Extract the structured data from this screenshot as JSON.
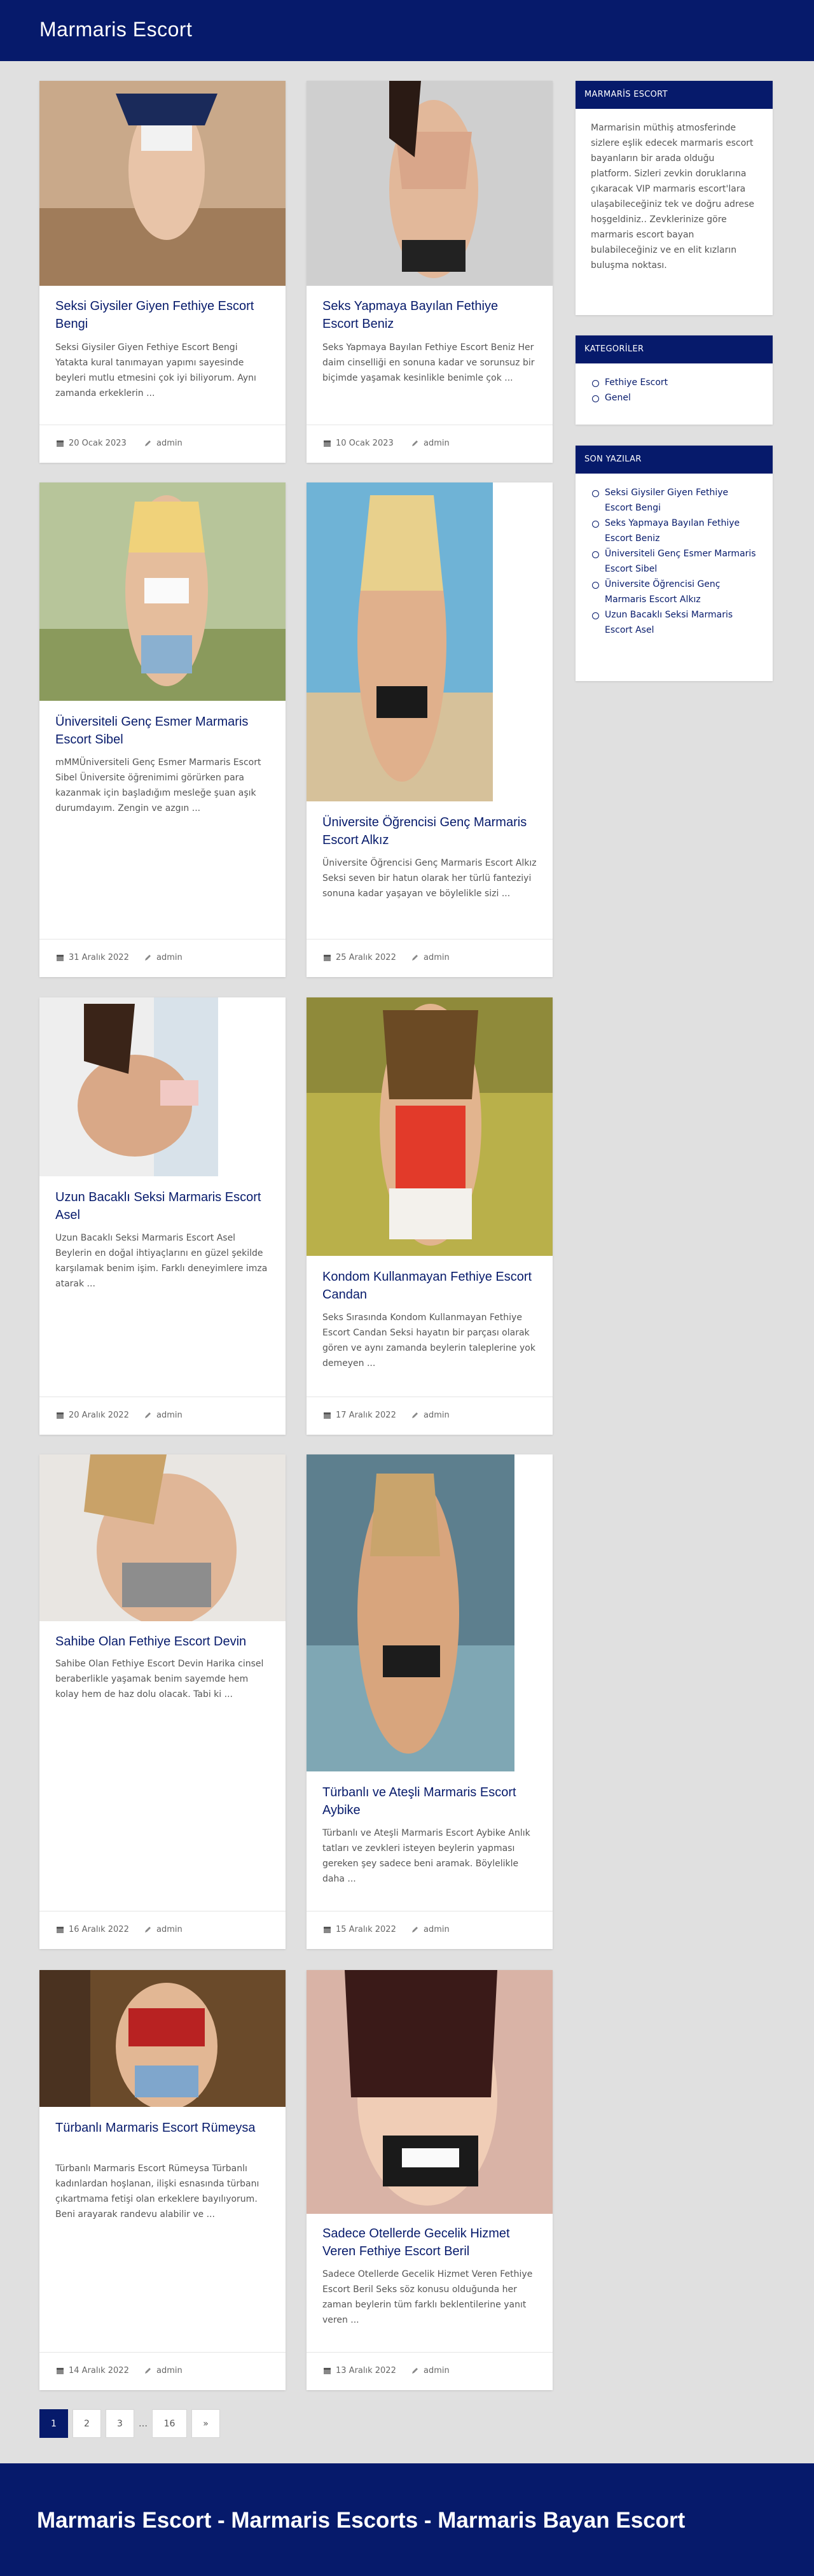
{
  "site": {
    "title": "Marmaris Escort"
  },
  "posts": [
    {
      "title": "Seksi Giysiler Giyen Fethiye Escort Bengi",
      "excerpt": "Seksi Giysiler Giyen Fethiye Escort Bengi Yatakta kural tanımayan yapımı sayesinde beyleri mutlu etmesini çok iyi biliyorum. Aynı zamanda erkeklerin ...",
      "date": "20 Ocak 2023",
      "author": "admin"
    },
    {
      "title": "Seks Yapmaya Bayılan Fethiye Escort Beniz",
      "excerpt": "Seks Yapmaya Bayılan Fethiye Escort Beniz Her daim cinselliği en sonuna kadar ve sorunsuz bir biçimde yaşamak kesinlikle benimle çok ...",
      "date": "10 Ocak 2023",
      "author": "admin"
    },
    {
      "title": "Üniversiteli Genç Esmer Marmaris Escort Sibel",
      "excerpt": "mMMÜniversiteli Genç Esmer Marmaris Escort Sibel Üniversite öğrenimimi görürken para kazanmak için başladığım mesleğe şuan aşık durumdayım. Zengin ve azgın ...",
      "date": "31 Aralık 2022",
      "author": "admin"
    },
    {
      "title": "Üniversite Öğrencisi Genç Marmaris Escort Alkız",
      "excerpt": "Üniversite Öğrencisi Genç Marmaris Escort Alkız Seksi seven bir hatun olarak her türlü fanteziyi sonuna kadar yaşayan ve böylelikle sizi ...",
      "date": "25 Aralık 2022",
      "author": "admin"
    },
    {
      "title": "Uzun Bacaklı Seksi Marmaris Escort Asel",
      "excerpt": "Uzun Bacaklı Seksi Marmaris Escort Asel Beylerin en doğal ihtiyaçlarını en güzel şekilde karşılamak benim işim. Farklı deneyimlere imza atarak ...",
      "date": "20 Aralık 2022",
      "author": "admin"
    },
    {
      "title": "Kondom Kullanmayan Fethiye Escort Candan",
      "excerpt": "Seks Sırasında Kondom Kullanmayan Fethiye Escort Candan Seksi hayatın bir parçası olarak gören ve aynı zamanda beylerin taleplerine yok demeyen ...",
      "date": "17 Aralık 2022",
      "author": "admin"
    },
    {
      "title": "Sahibe Olan Fethiye Escort Devin",
      "excerpt": "Sahibe Olan Fethiye Escort Devin Harika cinsel beraberlikle yaşamak benim sayemde hem kolay hem de haz dolu olacak. Tabi ki ...",
      "date": "16 Aralık 2022",
      "author": "admin"
    },
    {
      "title": "Türbanlı ve Ateşli Marmaris Escort Aybike",
      "excerpt": "Türbanlı ve Ateşli Marmaris Escort Aybike Anlık tatları ve zevkleri isteyen beylerin yapması gereken şey sadece beni aramak. Böylelikle daha ...",
      "date": "15 Aralık 2022",
      "author": "admin"
    },
    {
      "title": "Türbanlı Marmaris Escort Rümeysa",
      "excerpt": "Türbanlı Marmaris Escort Rümeysa Türbanlı kadınlardan hoşlanan, ilişki esnasında türbanı çıkartmama fetişi olan erkeklere bayılıyorum. Beni arayarak randevu alabilir ve ...",
      "date": "14 Aralık 2022",
      "author": "admin"
    },
    {
      "title": "Sadece Otellerde Gecelik Hizmet Veren Fethiye Escort Beril",
      "excerpt": "Sadece Otellerde Gecelik Hizmet Veren Fethiye Escort Beril Seks söz konusu olduğunda her zaman beylerin tüm farklı beklentilerine yanıt veren ...",
      "date": "13 Aralık 2022",
      "author": "admin"
    }
  ],
  "sidebar": {
    "about": {
      "heading": "MARMARİS ESCORT",
      "text": "Marmarisin müthiş atmosferinde sizlere eşlik edecek marmaris escort bayanların bir arada olduğu platform. Sizleri zevkin doruklarına çıkaracak VIP marmaris escort'lara ulaşabileceğiniz tek ve doğru adrese hoşgeldiniz.. Zevklerinize göre marmaris escort bayan bulabileceğiniz ve en elit kızların buluşma noktası."
    },
    "categories": {
      "heading": "KATEGORİLER",
      "items": [
        "Fethiye Escort",
        "Genel"
      ]
    },
    "recent": {
      "heading": "SON YAZILAR",
      "items": [
        "Seksi Giysiler Giyen Fethiye Escort Bengi",
        "Seks Yapmaya Bayılan Fethiye Escort Beniz",
        "Üniversiteli Genç Esmer Marmaris Escort Sibel",
        "Üniversite Öğrencisi Genç Marmaris Escort Alkız",
        "Uzun Bacaklı Seksi Marmaris Escort Asel"
      ]
    }
  },
  "pagination": {
    "pages": [
      "1",
      "2",
      "3",
      "…",
      "16",
      "»"
    ]
  },
  "footer": {
    "text": "Marmaris Escort - Marmaris Escorts - Marmaris Bayan Escort"
  },
  "colors": {
    "header": "#061a6b",
    "background": "#e0e0e0",
    "accent": "#061a6b"
  },
  "icons": {
    "date": "calendar-icon",
    "author": "pencil-icon"
  }
}
